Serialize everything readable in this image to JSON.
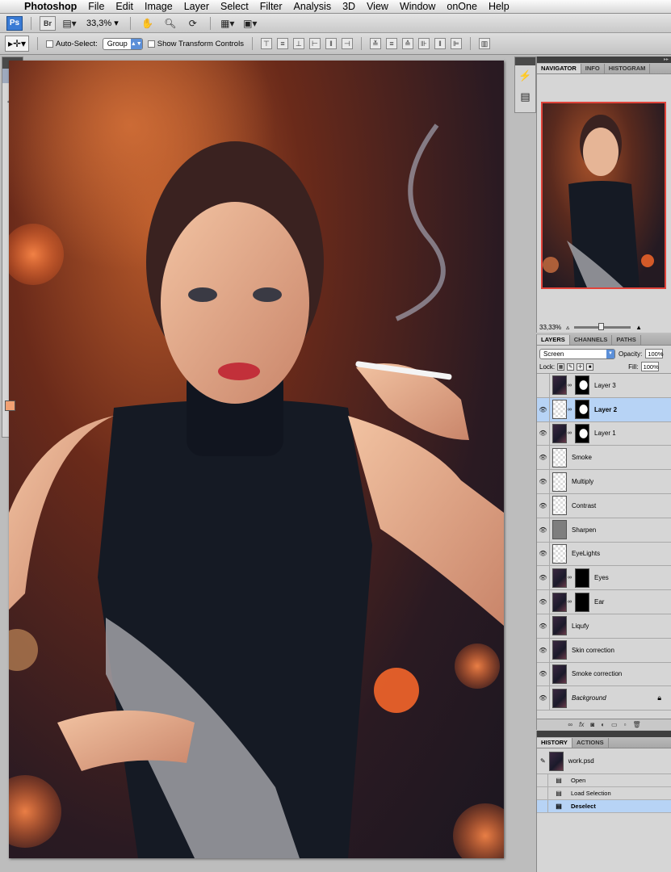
{
  "menubar": {
    "app_name": "Photoshop",
    "items": [
      "File",
      "Edit",
      "Image",
      "Layer",
      "Select",
      "Filter",
      "Analysis",
      "3D",
      "View",
      "Window",
      "onOne",
      "Help"
    ]
  },
  "appbar": {
    "ps_label": "Ps",
    "br_label": "Br",
    "zoom": "33,3%"
  },
  "options": {
    "auto_select_label": "Auto-Select:",
    "auto_select_value": "Group",
    "show_transform_label": "Show Transform Controls"
  },
  "navigator": {
    "tabs": [
      "NAVIGATOR",
      "INFO",
      "HISTOGRAM"
    ],
    "zoom": "33,33%"
  },
  "layers": {
    "tabs": [
      "LAYERS",
      "CHANNELS",
      "PATHS"
    ],
    "blend_mode": "Screen",
    "opacity_label": "Opacity:",
    "opacity": "100%",
    "lock_label": "Lock:",
    "fill_label": "Fill:",
    "fill": "100%",
    "items": [
      {
        "name": "Layer 3"
      },
      {
        "name": "Layer 2"
      },
      {
        "name": "Layer 1"
      },
      {
        "name": "Smoke"
      },
      {
        "name": "Multiply"
      },
      {
        "name": "Contrast"
      },
      {
        "name": "Sharpen"
      },
      {
        "name": "EyeLights"
      },
      {
        "name": "Eyes"
      },
      {
        "name": "Ear"
      },
      {
        "name": "Liqufy"
      },
      {
        "name": "Skin correction"
      },
      {
        "name": "Smoke correction"
      },
      {
        "name": "Background"
      }
    ]
  },
  "history": {
    "tabs": [
      "HISTORY",
      "ACTIONS"
    ],
    "snapshot": "work.psd",
    "items": [
      "Open",
      "Load Selection",
      "Deselect"
    ]
  }
}
